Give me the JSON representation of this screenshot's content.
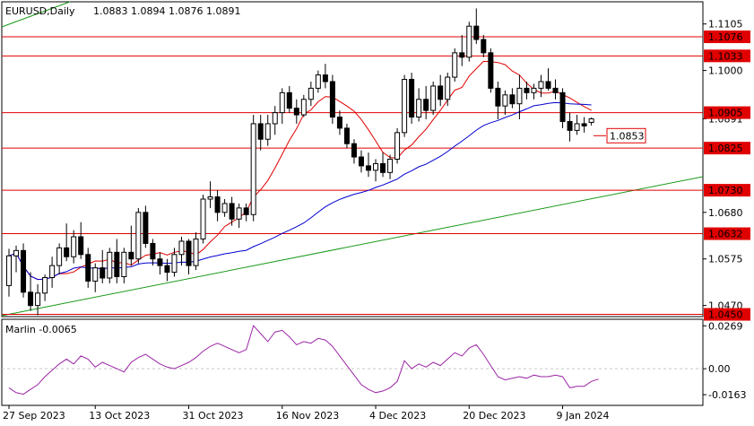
{
  "header": {
    "symbol": "EURUSD,Daily",
    "ohlc": "1.0883 1.0894 1.0876 1.0891"
  },
  "colors": {
    "background": "#ffffff",
    "frame": "#000000",
    "level_line": "#e00000",
    "level_label_bg": "#e00000",
    "ma_fast": "#e00000",
    "ma_slow": "#0000d0",
    "trendline": "#1a9a1a",
    "marlin": "#9b26a6",
    "grid": "#c8c8c8"
  },
  "chart_data": [
    {
      "type": "candlestick",
      "title": "EURUSD,Daily",
      "ylim": [
        1.0445,
        1.1155
      ],
      "price_ticks": [
        "1.1105",
        "1.1000",
        "1.0891",
        "1.0680",
        "1.0575",
        "1.0470"
      ],
      "x_ticks": [
        "27 Sep 2023",
        "13 Oct 2023",
        "31 Oct 2023",
        "16 Nov 2023",
        "4 Dec 2023",
        "20 Dec 2023",
        "9 Jan 2024"
      ],
      "x_tick_bar_index": [
        0,
        12,
        25,
        38,
        51,
        64,
        77
      ],
      "horizontal_levels": [
        "1.1076",
        "1.1033",
        "1.0905",
        "1.0825",
        "1.0730",
        "1.0632",
        "1.0450"
      ],
      "marked_level": "1.0853",
      "candles": [
        [
          1.0515,
          1.0598,
          1.049,
          1.0582
        ],
        [
          1.0582,
          1.0605,
          1.0545,
          1.0594
        ],
        [
          1.0594,
          1.061,
          1.0488,
          1.05
        ],
        [
          1.05,
          1.0545,
          1.0458,
          1.047
        ],
        [
          1.047,
          1.0518,
          1.0448,
          1.0498
        ],
        [
          1.0498,
          1.054,
          1.048,
          1.0533
        ],
        [
          1.0533,
          1.058,
          1.051,
          1.056
        ],
        [
          1.056,
          1.061,
          1.054,
          1.06
        ],
        [
          1.06,
          1.0655,
          1.057,
          1.058
        ],
        [
          1.058,
          1.064,
          1.0565,
          1.0625
        ],
        [
          1.0625,
          1.0658,
          1.0575,
          1.0585
        ],
        [
          1.0585,
          1.06,
          1.051,
          1.0525
        ],
        [
          1.0525,
          1.0565,
          1.05,
          1.0555
        ],
        [
          1.0555,
          1.0595,
          1.052,
          1.0532
        ],
        [
          1.0532,
          1.06,
          1.052,
          1.059
        ],
        [
          1.059,
          1.062,
          1.052,
          1.0535
        ],
        [
          1.0535,
          1.06,
          1.052,
          1.059
        ],
        [
          1.059,
          1.065,
          1.056,
          1.0575
        ],
        [
          1.0575,
          1.069,
          1.0565,
          1.068
        ],
        [
          1.068,
          1.0695,
          1.06,
          1.061
        ],
        [
          1.061,
          1.062,
          1.056,
          1.0575
        ],
        [
          1.0575,
          1.059,
          1.054,
          1.056
        ],
        [
          1.056,
          1.0575,
          1.0525,
          1.0545
        ],
        [
          1.0545,
          1.06,
          1.0535,
          1.0585
        ],
        [
          1.0585,
          1.0625,
          1.056,
          1.0615
        ],
        [
          1.0615,
          1.062,
          1.054,
          1.056
        ],
        [
          1.056,
          1.0635,
          1.055,
          1.062
        ],
        [
          1.062,
          1.072,
          1.061,
          1.071
        ],
        [
          1.071,
          1.075,
          1.069,
          1.0715
        ],
        [
          1.0715,
          1.073,
          1.066,
          1.068
        ],
        [
          1.068,
          1.071,
          1.067,
          1.07
        ],
        [
          1.07,
          1.0715,
          1.065,
          1.0665
        ],
        [
          1.0665,
          1.07,
          1.0645,
          1.069
        ],
        [
          1.069,
          1.07,
          1.066,
          1.0675
        ],
        [
          1.0675,
          1.09,
          1.066,
          1.088
        ],
        [
          1.088,
          1.09,
          1.082,
          1.0845
        ],
        [
          1.0845,
          1.09,
          1.083,
          1.088
        ],
        [
          1.088,
          1.092,
          1.0855,
          1.0905
        ],
        [
          1.0905,
          1.096,
          1.088,
          1.095
        ],
        [
          1.095,
          1.0965,
          1.0905,
          1.0915
        ],
        [
          1.0915,
          1.0935,
          1.088,
          1.09
        ],
        [
          1.09,
          1.0945,
          1.0895,
          1.0935
        ],
        [
          1.0935,
          1.0975,
          1.092,
          1.096
        ],
        [
          1.096,
          1.1,
          1.095,
          1.099
        ],
        [
          1.099,
          1.1015,
          1.096,
          1.0975
        ],
        [
          1.0975,
          1.099,
          1.088,
          1.0895
        ],
        [
          1.0895,
          1.091,
          1.0855,
          1.087
        ],
        [
          1.087,
          1.088,
          1.0825,
          1.0835
        ],
        [
          1.0835,
          1.0845,
          1.079,
          1.0805
        ],
        [
          1.0805,
          1.082,
          1.077,
          1.0785
        ],
        [
          1.0785,
          1.0815,
          1.076,
          1.0775
        ],
        [
          1.0775,
          1.08,
          1.075,
          1.079
        ],
        [
          1.079,
          1.0815,
          1.076,
          1.077
        ],
        [
          1.077,
          1.081,
          1.0755,
          1.08
        ],
        [
          1.08,
          1.087,
          1.079,
          1.086
        ],
        [
          1.086,
          1.099,
          1.085,
          1.098
        ],
        [
          1.098,
          1.0995,
          1.088,
          1.0895
        ],
        [
          1.0895,
          1.096,
          1.0885,
          1.0935
        ],
        [
          1.0935,
          1.0965,
          1.089,
          1.091
        ],
        [
          1.091,
          1.0975,
          1.09,
          1.0965
        ],
        [
          1.0965,
          1.099,
          1.092,
          1.0935
        ],
        [
          1.0935,
          1.0995,
          1.092,
          1.0985
        ],
        [
          1.0985,
          1.105,
          1.0975,
          1.104
        ],
        [
          1.104,
          1.108,
          1.101,
          1.103
        ],
        [
          1.103,
          1.111,
          1.102,
          1.11
        ],
        [
          1.11,
          1.114,
          1.106,
          1.107
        ],
        [
          1.107,
          1.108,
          1.103,
          1.104
        ],
        [
          1.104,
          1.105,
          1.095,
          1.096
        ],
        [
          1.096,
          1.0975,
          1.089,
          1.092
        ],
        [
          1.092,
          1.0955,
          1.09,
          1.0945
        ],
        [
          1.0945,
          1.096,
          1.0915,
          1.0925
        ],
        [
          1.0925,
          1.099,
          1.089,
          1.096
        ],
        [
          1.096,
          1.0975,
          1.0935,
          1.095
        ],
        [
          1.095,
          1.097,
          1.0935,
          1.096
        ],
        [
          1.096,
          1.099,
          1.094,
          1.0975
        ],
        [
          1.0975,
          1.1005,
          1.0955,
          1.096
        ],
        [
          1.096,
          1.098,
          1.0935,
          1.095
        ],
        [
          1.095,
          1.096,
          1.087,
          1.0885
        ],
        [
          1.0885,
          1.0905,
          1.084,
          1.0865
        ],
        [
          1.0865,
          1.09,
          1.0855,
          1.088
        ],
        [
          1.088,
          1.0895,
          1.086,
          1.0875
        ],
        [
          1.0883,
          1.0894,
          1.0876,
          1.0891
        ]
      ]
    },
    {
      "type": "line",
      "title": "Marlin -0.0065",
      "ylim": [
        -0.023,
        0.031
      ],
      "y_ticks": [
        "0.0269",
        "0.00",
        "-0.0163"
      ],
      "values": [
        -0.012,
        -0.015,
        -0.016,
        -0.013,
        -0.01,
        -0.005,
        -0.001,
        0.003,
        0.006,
        0.003,
        0.008,
        0.006,
        0.001,
        0.004,
        0.002,
        0.0,
        -0.002,
        0.004,
        0.007,
        0.009,
        0.006,
        0.003,
        0.001,
        0.0,
        0.002,
        0.004,
        0.007,
        0.011,
        0.014,
        0.016,
        0.014,
        0.012,
        0.01,
        0.012,
        0.027,
        0.022,
        0.017,
        0.023,
        0.024,
        0.02,
        0.015,
        0.017,
        0.016,
        0.019,
        0.018,
        0.014,
        0.008,
        0.002,
        -0.004,
        -0.01,
        -0.013,
        -0.015,
        -0.014,
        -0.012,
        -0.008,
        0.005,
        0.0,
        0.003,
        0.001,
        0.004,
        0.002,
        0.006,
        0.01,
        0.008,
        0.013,
        0.015,
        0.009,
        0.002,
        -0.005,
        -0.007,
        -0.006,
        -0.005,
        -0.006,
        -0.004,
        -0.005,
        -0.005,
        -0.004,
        -0.005,
        -0.012,
        -0.011,
        -0.011,
        -0.008,
        -0.0065
      ]
    }
  ]
}
